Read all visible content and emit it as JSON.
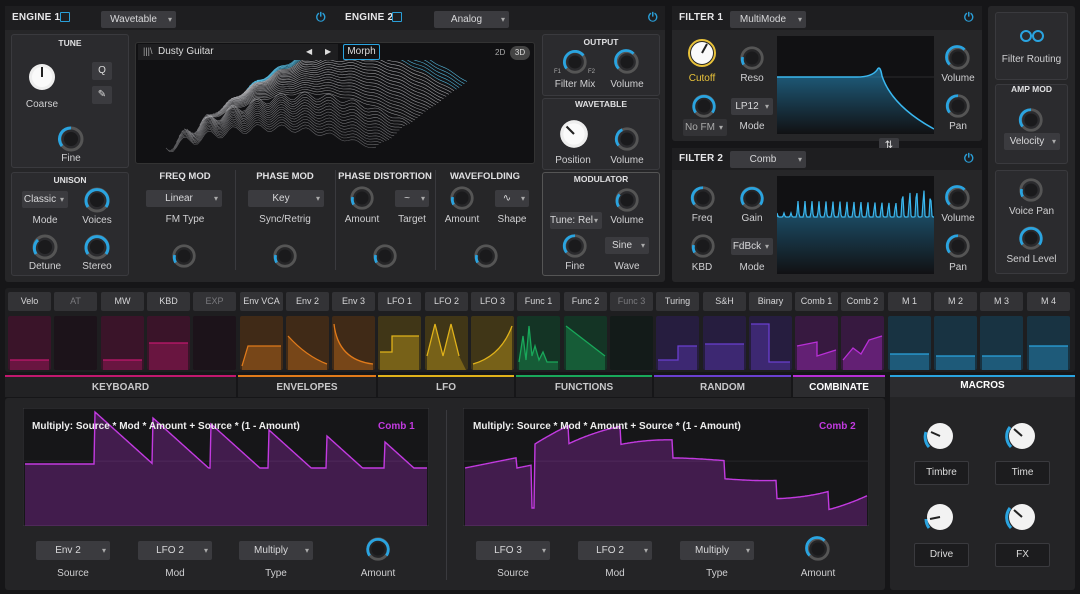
{
  "engine1": {
    "title": "ENGINE 1",
    "type": "Wavetable"
  },
  "engine2": {
    "title": "ENGINE 2",
    "type": "Analog"
  },
  "tune": {
    "title": "TUNE",
    "coarse": "Coarse",
    "fine": "Fine",
    "q": "Q",
    "pencil": "✎"
  },
  "unison": {
    "title": "UNISON",
    "mode_value": "Classic",
    "mode": "Mode",
    "voices": "Voices",
    "detune": "Detune",
    "stereo": "Stereo"
  },
  "wavetable_display": {
    "name": "Dusty Guitar",
    "morph": "Morph",
    "btn2d": "2D",
    "btn3d": "3D",
    "prev": "◀",
    "next": "▶",
    "bars": "|||\\"
  },
  "output": {
    "title": "OUTPUT",
    "filter_mix": "Filter Mix",
    "volume": "Volume",
    "f1": "F1",
    "f2": "F2"
  },
  "wavetable_sec": {
    "title": "WAVETABLE",
    "position": "Position",
    "volume": "Volume"
  },
  "modulator": {
    "title": "MODULATOR",
    "tune_value": "Tune: Rel",
    "volume": "Volume",
    "fine": "Fine",
    "wave_value": "Sine",
    "wave": "Wave"
  },
  "freqmod": {
    "title": "FREQ MOD",
    "value": "Linear",
    "label": "FM Type"
  },
  "phasemod": {
    "title": "PHASE MOD",
    "value": "Key",
    "label": "Sync/Retrig"
  },
  "phasedist": {
    "title": "PHASE DISTORTION",
    "amount": "Amount",
    "target": "Target"
  },
  "wavefold": {
    "title": "WAVEFOLDING",
    "amount": "Amount",
    "shape": "Shape"
  },
  "filter1": {
    "title": "FILTER 1",
    "type": "MultiMode",
    "cutoff": "Cutoff",
    "reso": "Reso",
    "fm_value": "No FM",
    "mode_value": "LP12",
    "mode": "Mode",
    "volume": "Volume",
    "pan": "Pan"
  },
  "filter2": {
    "title": "FILTER 2",
    "type": "Comb",
    "freq": "Freq",
    "gain": "Gain",
    "kbd": "KBD",
    "mode_value": "FdBck",
    "mode": "Mode",
    "volume": "Volume",
    "pan": "Pan"
  },
  "routing": {
    "label": "Filter Routing"
  },
  "ampmod": {
    "title": "AMP MOD",
    "value": "Velocity"
  },
  "voicepan": {
    "voice_pan": "Voice Pan",
    "send_level": "Send Level"
  },
  "sources": [
    "Velo",
    "AT",
    "MW",
    "KBD",
    "EXP",
    "Env VCA",
    "Env 2",
    "Env 3",
    "LFO 1",
    "LFO 2",
    "LFO 3",
    "Func 1",
    "Func 2",
    "Func 3",
    "Turing",
    "S&H",
    "Binary",
    "Comb 1",
    "Comb 2",
    "M 1",
    "M 2",
    "M 3",
    "M 4"
  ],
  "tabs": [
    "KEYBOARD",
    "ENVELOPES",
    "LFO",
    "FUNCTIONS",
    "RANDOM",
    "COMBINATE"
  ],
  "comb1": {
    "formula": "Multiply: Source * Mod * Amount + Source * (1 - Amount)",
    "name": "Comb 1",
    "source_value": "Env 2",
    "source": "Source",
    "mod_value": "LFO 2",
    "mod": "Mod",
    "type_value": "Multiply",
    "type": "Type",
    "amount": "Amount"
  },
  "comb2": {
    "formula": "Multiply: Source * Mod * Amount + Source * (1 - Amount)",
    "name": "Comb 2",
    "source_value": "LFO 3",
    "source": "Source",
    "mod_value": "LFO 2",
    "mod": "Mod",
    "type_value": "Multiply",
    "type": "Type",
    "amount": "Amount"
  },
  "macros": {
    "title": "MACROS",
    "timbre": "Timbre",
    "time": "Time",
    "drive": "Drive",
    "fx": "FX"
  },
  "colors": {
    "accent": "#2aa4e0",
    "keyboard": "#c2186e",
    "envelopes": "#e07a1a",
    "lfo": "#e0b21a",
    "functions": "#19a85a",
    "random": "#6a3fd0",
    "combinate": "#b82fd6",
    "macros": "#2aa4e0"
  }
}
